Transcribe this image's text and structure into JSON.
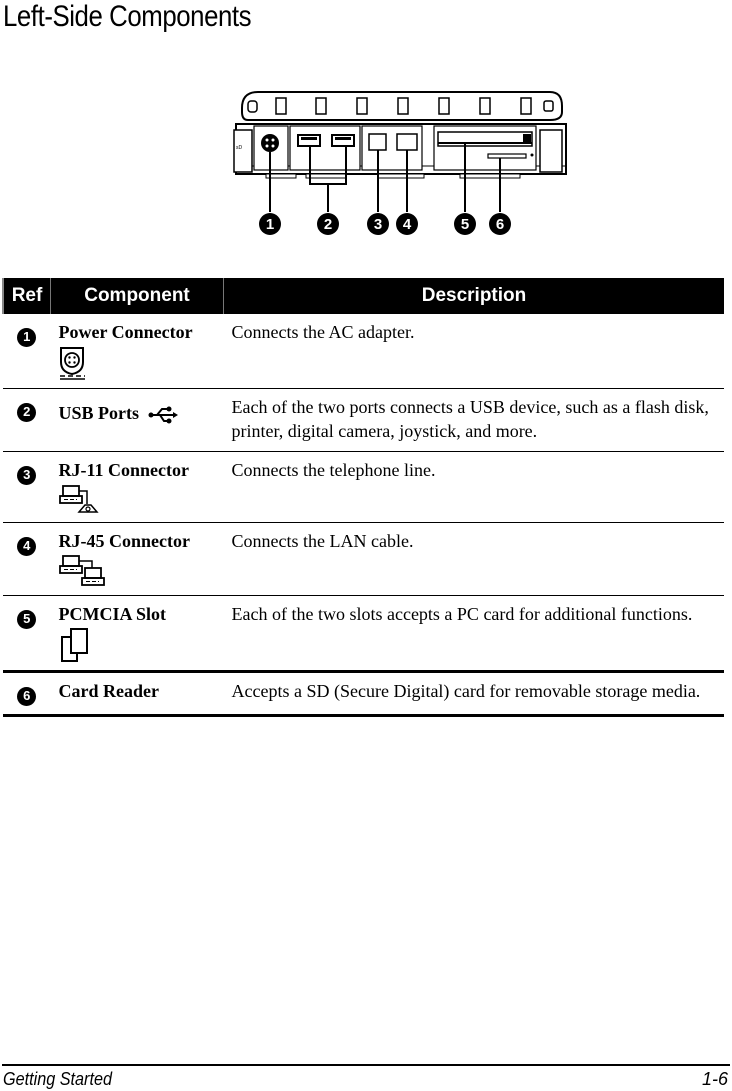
{
  "page": {
    "title": "Left-Side Components"
  },
  "figure": {
    "description": "Left side view of notebook with numbered callouts",
    "callouts": [
      "1",
      "2",
      "3",
      "4",
      "5",
      "6"
    ]
  },
  "table": {
    "headers": {
      "ref": "Ref",
      "component": "Component",
      "description": "Description"
    },
    "rows": [
      {
        "ref": "1",
        "name": "Power Connector",
        "icon": "power-connector-icon",
        "description": "Connects the AC adapter."
      },
      {
        "ref": "2",
        "name": "USB Ports",
        "icon": "usb-icon",
        "description": "Each of the two ports connects a USB device, such as a flash disk, printer, digital camera, joystick, and more."
      },
      {
        "ref": "3",
        "name": "RJ-11 Connector",
        "icon": "rj11-modem-icon",
        "description": "Connects the telephone line."
      },
      {
        "ref": "4",
        "name": "RJ-45 Connector",
        "icon": "rj45-network-icon",
        "description": "Connects the LAN cable."
      },
      {
        "ref": "5",
        "name": "PCMCIA Slot",
        "icon": "pc-card-icon",
        "description": "Each of the two slots accepts a PC card for additional functions."
      },
      {
        "ref": "6",
        "name": "Card Reader",
        "icon": "",
        "description": "Accepts a SD (Secure Digital) card for removable storage media."
      }
    ]
  },
  "footer": {
    "section": "Getting Started",
    "page_number": "1-6"
  }
}
